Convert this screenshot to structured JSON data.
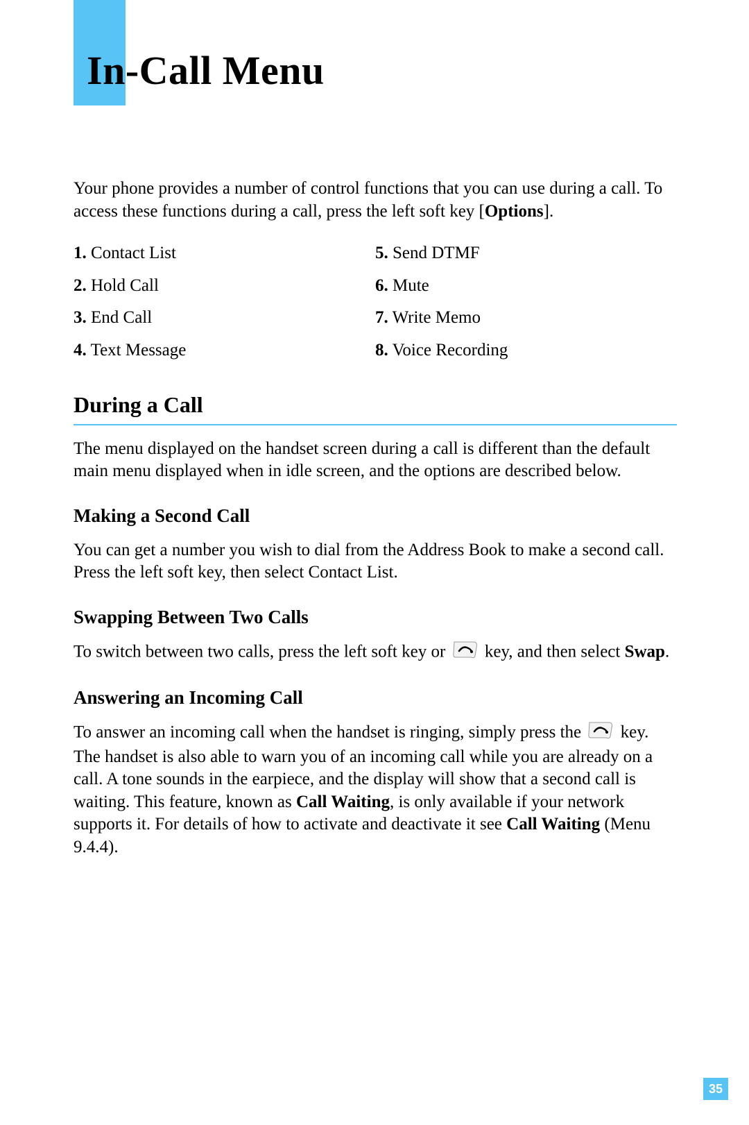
{
  "chapter_title": "In-Call Menu",
  "intro": {
    "text1": "Your phone provides a number of control functions that you can use during a call. To access these functions during a call, press the left soft key [",
    "bold": "Options",
    "text2": "]."
  },
  "options": {
    "left": [
      {
        "num": "1.",
        "label": "Contact List"
      },
      {
        "num": "2.",
        "label": "Hold Call"
      },
      {
        "num": "3.",
        "label": "End Call"
      },
      {
        "num": "4.",
        "label": "Text Message"
      }
    ],
    "right": [
      {
        "num": "5.",
        "label": "Send DTMF"
      },
      {
        "num": "6.",
        "label": "Mute"
      },
      {
        "num": "7.",
        "label": "Write Memo"
      },
      {
        "num": "8.",
        "label": "Voice Recording"
      }
    ]
  },
  "section_during": {
    "heading": "During a Call",
    "para": "The menu displayed on the handset screen during a call is different than the default main menu displayed when in idle screen, and the options are described below."
  },
  "sub_second_call": {
    "heading": "Making a Second Call",
    "para": "You can get a number you wish to dial from the Address Book to make a second call. Press the left soft key, then select Contact List."
  },
  "sub_swapping": {
    "heading": "Swapping Between Two Calls",
    "p1": "To switch between two calls, press the left soft key or ",
    "p2": " key, and then select ",
    "bold": "Swap",
    "p3": "."
  },
  "sub_answering": {
    "heading": "Answering an Incoming Call",
    "p1": "To answer an incoming call when the handset is ringing, simply press the ",
    "p2": " key. The handset is also able to warn you of an incoming call while you are already on a call. A tone sounds in the earpiece, and the display will show that a second call is waiting. This feature, known as ",
    "bold1": "Call Waiting",
    "p3": ", is only available if your network supports it. For details of how to activate and deactivate it see ",
    "bold2": "Call Waiting",
    "p4": " (Menu 9.4.4)."
  },
  "page_number": "35"
}
